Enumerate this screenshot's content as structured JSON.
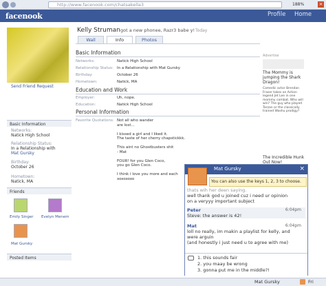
{
  "browser": {
    "url": "http://www.facenook.com/chatsakella3",
    "zoom": "188%"
  },
  "nav": {
    "logo": "facenook",
    "profile": "Profile",
    "home": "Home"
  },
  "profile": {
    "name": "Kelly Struman",
    "status": "got a new phonee, Razr3 babe y!",
    "status_time": "Today",
    "send_request": "Send Friend Request",
    "tabs": [
      "Wall",
      "Info",
      "Photos"
    ],
    "sections": {
      "basic": "Basic Information",
      "education": "Education and Work",
      "personal": "Personal Information"
    },
    "basic": [
      {
        "k": "Networks:",
        "v": "Natick High School"
      },
      {
        "k": "Relationship Status:",
        "v": "In a Relationship with Mat Gursky"
      },
      {
        "k": "Birthday:",
        "v": "October 26"
      },
      {
        "k": "Hometown:",
        "v": "Natick, MA"
      }
    ],
    "education": [
      {
        "k": "Employer:",
        "v": "Uh, nope."
      },
      {
        "k": "Education:",
        "v": "Natick High School"
      }
    ],
    "quotations_label": "Favorite Quotations:",
    "quotations": [
      "Not all who wander",
      "are lost...",
      "",
      "I kissed a girl and I liked it.",
      "The taste of her cherry chapstickkk.",
      "",
      "This aint no Ghostbusters shit",
      "- Mat",
      "",
      "FOUR! for you Glen Coco,",
      "you go Glen Coco.",
      "",
      "I think i love you more and each",
      "xoxoxoxo"
    ]
  },
  "left": {
    "basic_title": "Basic Information",
    "fields": [
      {
        "k": "Networks:",
        "v": "Natick High School"
      },
      {
        "k": "Relationship Status:",
        "v": "In a Relationship with"
      },
      {
        "k": "",
        "v": "Mat Gursky",
        "link": true
      },
      {
        "k": "Birthday:",
        "v": "October 26"
      },
      {
        "k": "Hometown:",
        "v": "Natick, MA"
      }
    ],
    "friends_title": "Friends",
    "friends": [
      "Emily Singer",
      "Evelyn Menem",
      "Mat Gursky"
    ],
    "posted_title": "Posted Items"
  },
  "ads": {
    "label": "Advertise",
    "ad1_title": "The Mommy is jumping the Shark Dragon!",
    "ad1_text": "Comedic actor Brendan Fraser takes on Action legend Jet Lee in one mommy combat. Who will win? The guy who played Tarzan or the classically trained Washu prodigy?",
    "ad2_title": "The Incredible Hunk Out Now!"
  },
  "chat": {
    "title": "Mat Gursky",
    "tip": "You can also use the keys 1, 2, 3 to choose.",
    "cut_line": "thats wih her deen saying.",
    "lines": [
      "well thank god u joined cuz i need ur opinion",
      "on a veryyy important subject"
    ],
    "peter_name": "Peter",
    "peter_time": "6:04pm",
    "peter_msg": "Steve: the answer is 42!",
    "mat_name": "Mat",
    "mat_time": "6:04pm",
    "mat_msg": [
      "loll no really, im makin a playlist for kelly, and",
      "were arguin",
      "(and honestly i just need u to agree with me)"
    ],
    "options": [
      "1. this sounds fair",
      "2. you maay be wrong",
      "3. gonna put me in the middle?!"
    ]
  },
  "statusbar": {
    "chat_name": "Mat Gursky",
    "fri": "Fri"
  }
}
